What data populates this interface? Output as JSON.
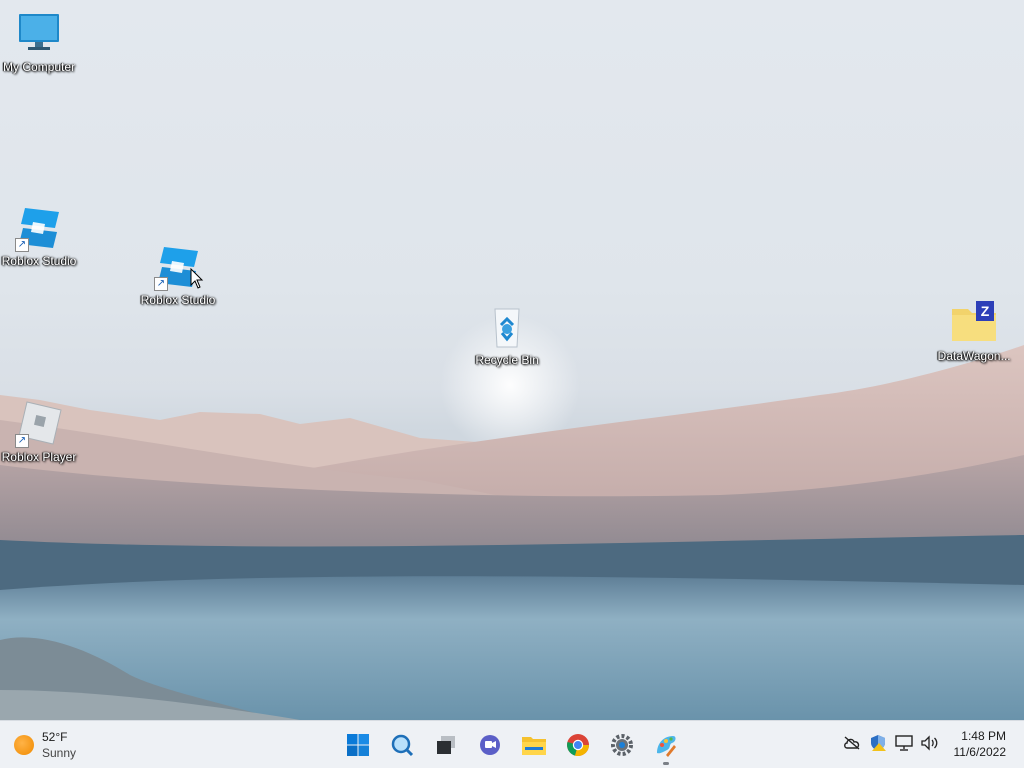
{
  "desktop": {
    "icons": [
      {
        "label": "My Computer"
      },
      {
        "label": "Roblox Studio"
      },
      {
        "label": "Roblox Studio"
      },
      {
        "label": "Recycle Bin"
      },
      {
        "label": "DataWagon..."
      },
      {
        "label": "Roblox Player"
      }
    ]
  },
  "taskbar": {
    "weather": {
      "temperature": "52°F",
      "condition": "Sunny"
    },
    "apps": [
      {
        "icon": "windows-start-icon"
      },
      {
        "icon": "search-icon"
      },
      {
        "icon": "task-view-icon"
      },
      {
        "icon": "chat-icon"
      },
      {
        "icon": "file-explorer-icon"
      },
      {
        "icon": "chrome-icon"
      },
      {
        "icon": "settings-gear-icon"
      },
      {
        "icon": "paint-app-icon"
      }
    ],
    "tray": [
      {
        "icon": "cloud-offline-icon"
      },
      {
        "icon": "security-shield-icon"
      },
      {
        "icon": "network-icon"
      },
      {
        "icon": "volume-icon"
      }
    ],
    "clock": {
      "time": "1:48 PM",
      "date": "11/6/2022"
    }
  },
  "colors": {
    "taskbar_bg": "#eef1f5",
    "accent_blue": "#0a7ad8",
    "sky": "#e3e8ee",
    "water": "#6d93ab"
  }
}
